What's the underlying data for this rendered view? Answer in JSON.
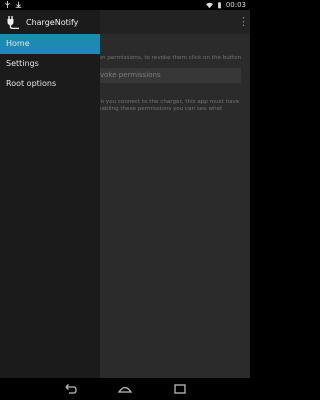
{
  "status_bar": {
    "left_icons": [
      "usb-icon",
      "download-icon"
    ],
    "right_icons": [
      "wifi-icon",
      "battery-icon",
      "clock-icon"
    ],
    "time": "00:03"
  },
  "app": {
    "title": "ChargeNotify",
    "icon": "plug-icon",
    "overflow_icon": "overflow-menu-icon"
  },
  "drawer": {
    "items": [
      {
        "label": "Home",
        "selected": true
      },
      {
        "label": "Settings",
        "selected": false
      },
      {
        "label": "Root options",
        "selected": false
      }
    ]
  },
  "content": {
    "line1": "ion permissions, to revoke them click on the button",
    "button_label": "voke permissions",
    "line2": "en you connect to the charger, this app must have",
    "line3": "isabling these permissions you can see what"
  },
  "nav_bar": {
    "buttons": [
      "back-icon",
      "home-icon",
      "recents-icon"
    ]
  },
  "colors": {
    "accent": "#1e8ab3",
    "drawer_bg": "#1b1b1b",
    "content_bg": "#3a3a3a"
  }
}
